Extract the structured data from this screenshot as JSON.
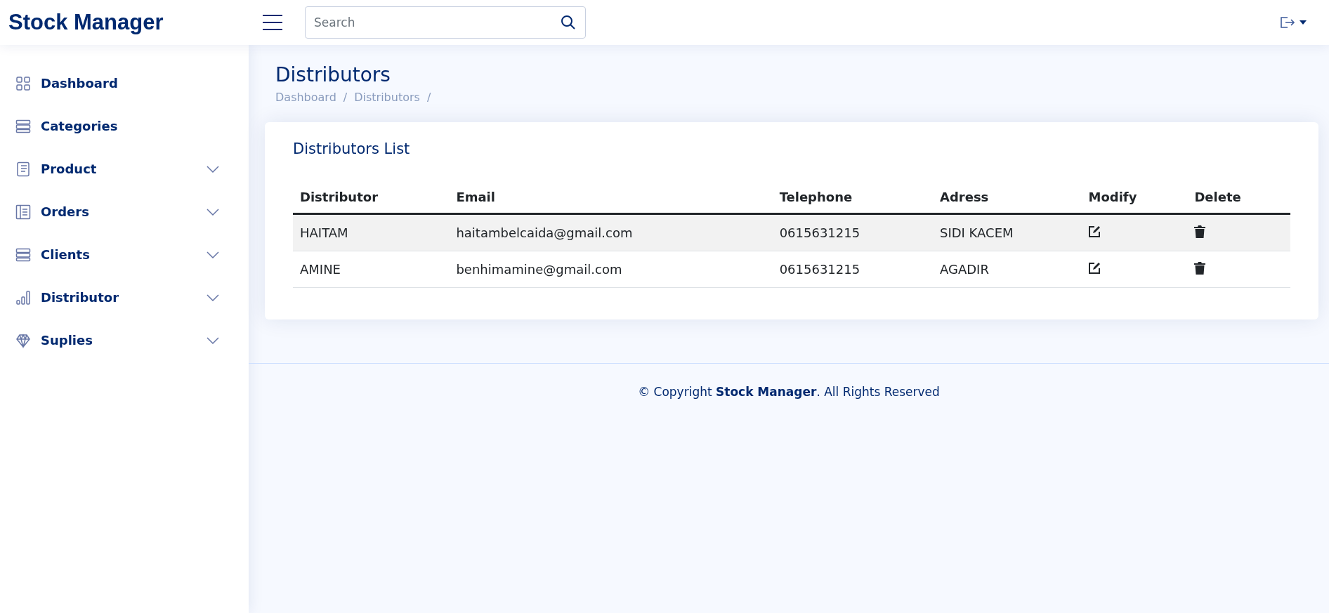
{
  "header": {
    "logo": "Stock Manager",
    "search": {
      "placeholder": "Search"
    }
  },
  "sidebar": {
    "items": [
      {
        "label": "Dashboard",
        "kind": "link"
      },
      {
        "label": "Categories",
        "kind": "link"
      },
      {
        "label": "Product",
        "kind": "group",
        "expanded": false
      },
      {
        "label": "Orders",
        "kind": "group",
        "expanded": false
      },
      {
        "label": "Clients",
        "kind": "group",
        "expanded": false
      },
      {
        "label": "Distributor",
        "kind": "group",
        "expanded": false
      },
      {
        "label": "Suplies",
        "kind": "group",
        "expanded": false
      }
    ]
  },
  "page": {
    "title": "Distributors",
    "breadcrumb": [
      {
        "label": "Dashboard",
        "separator": "/"
      },
      {
        "label": "Distributors",
        "separator": "/"
      }
    ]
  },
  "card": {
    "title": "Distributors List",
    "table": {
      "columns": [
        "Distributor",
        "Email",
        "Telephone",
        "Adress",
        "Modify",
        "Delete"
      ],
      "rows": [
        {
          "distributor": "HAITAM",
          "email": "haitambelcaida@gmail.com",
          "telephone": "0615631215",
          "adress": "SIDI KACEM"
        },
        {
          "distributor": "AMINE",
          "email": "benhimamine@gmail.com",
          "telephone": "0615631215",
          "adress": "AGADIR"
        }
      ]
    }
  },
  "footer": {
    "text": "© Copyright **Stock Manager**. All Rights Reserved"
  }
}
